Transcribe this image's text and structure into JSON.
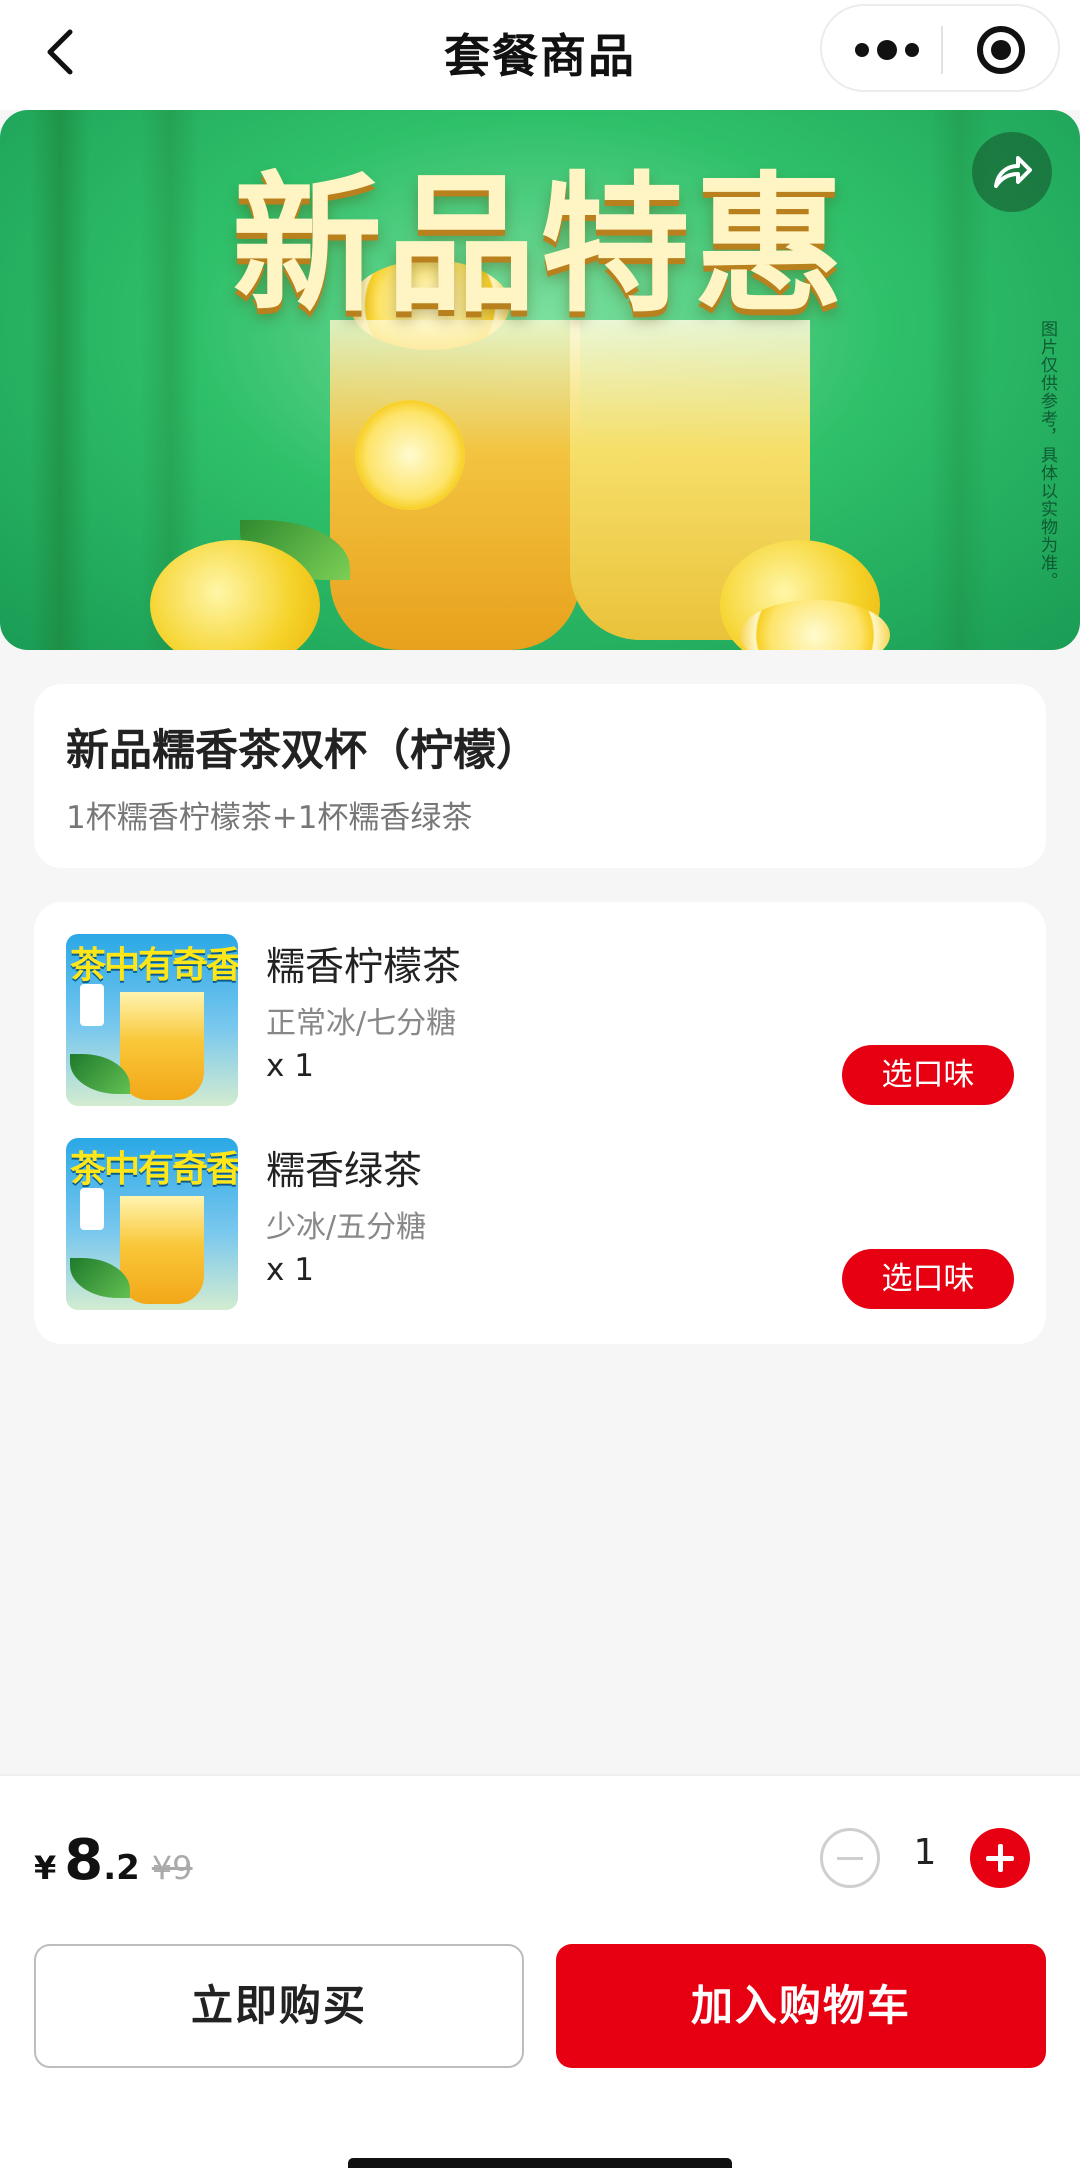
{
  "header": {
    "title": "套餐商品",
    "back_icon": "chevron-left-icon",
    "more_icon": "more-dots-icon",
    "close_icon": "target-circle-icon"
  },
  "hero": {
    "headline": "新品特惠",
    "side_note": "图片仅供参考，具体以实物为准。",
    "share_icon": "share-icon"
  },
  "combo": {
    "title": "新品糯香茶双杯（柠檬）",
    "description": "1杯糯香柠檬茶+1杯糯香绿茶"
  },
  "items": [
    {
      "thumb_title": "茶中有奇香",
      "name": "糯香柠檬茶",
      "spec": "正常冰/七分糖",
      "qty": "x 1",
      "button": "选口味"
    },
    {
      "thumb_title": "茶中有奇香",
      "name": "糯香绿茶",
      "spec": "少冰/五分糖",
      "qty": "x 1",
      "button": "选口味"
    }
  ],
  "purchase": {
    "currency": "¥",
    "price_int": "8",
    "price_dec": ".2",
    "original_price": "¥9",
    "quantity": "1"
  },
  "actions": {
    "buy_now": "立即购买",
    "add_to_cart": "加入购物车"
  },
  "colors": {
    "accent": "#e60012",
    "background": "#f6f6f6",
    "card": "#ffffff"
  }
}
